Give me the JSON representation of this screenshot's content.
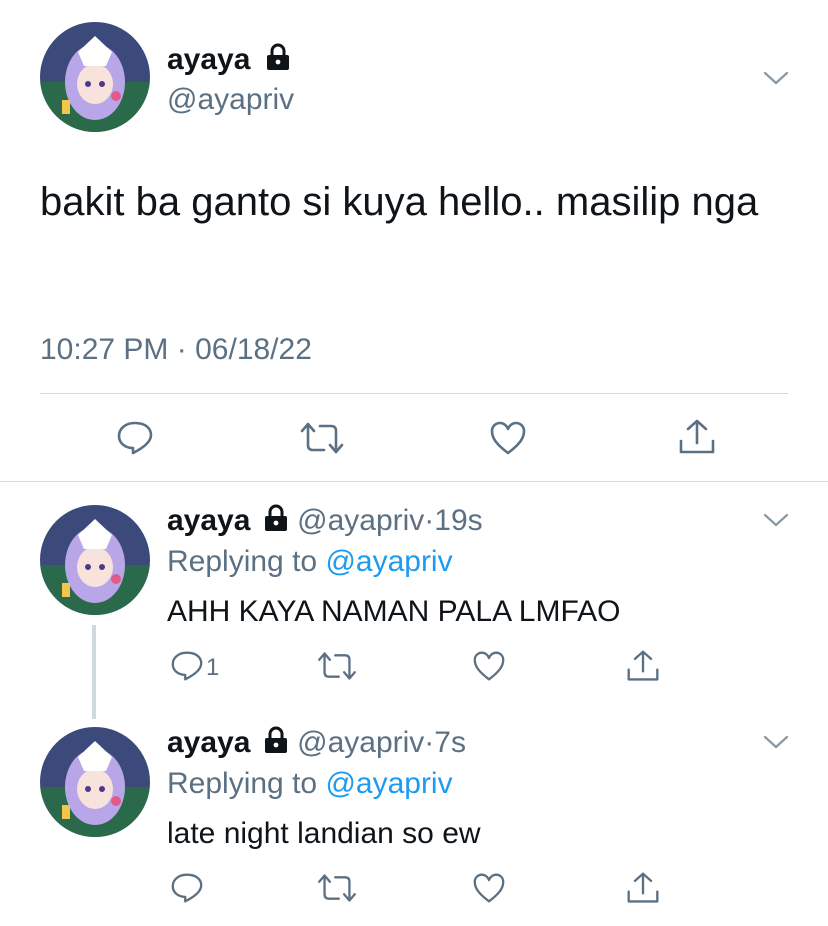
{
  "main_tweet": {
    "display_name": "ayaya",
    "handle": "@ayapriv",
    "text": "bakit ba ganto si kuya hello.. masilip nga",
    "time": "10:27 PM",
    "separator": "·",
    "date": "06/18/22"
  },
  "replies": [
    {
      "display_name": "ayaya",
      "handle": "@ayapriv",
      "separator": "·",
      "age": "19s",
      "replying_label": "Replying to",
      "replying_to": "@ayapriv",
      "text": "AHH KAYA NAMAN PALA LMFAO",
      "reply_count": "1"
    },
    {
      "display_name": "ayaya",
      "handle": "@ayapriv",
      "separator": "·",
      "age": "7s",
      "replying_label": "Replying to",
      "replying_to": "@ayapriv",
      "text": "late night landian so ew",
      "reply_count": ""
    }
  ],
  "icons": {
    "lock": "lock-icon",
    "menu": "chevron-down-icon",
    "reply": "reply-icon",
    "retweet": "retweet-icon",
    "like": "heart-icon",
    "share": "share-icon"
  },
  "colors": {
    "text": "#0f1419",
    "secondary": "#5b7083",
    "link": "#1d9bf0",
    "divider": "#cfd9de"
  }
}
